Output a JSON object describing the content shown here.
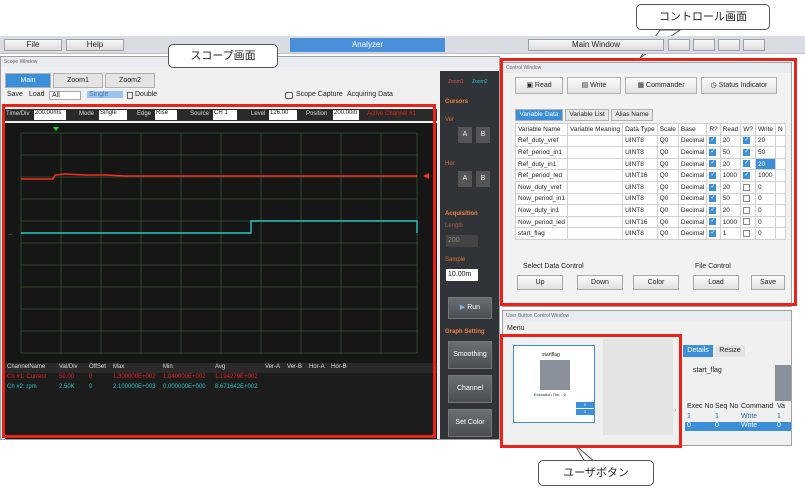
{
  "menubar": {
    "file": "File",
    "help": "Help",
    "analyzer": "Analyzer",
    "main_window": "Main Window"
  },
  "callouts": {
    "scope": "スコープ画面",
    "control": "コントロール画面",
    "user_button": "ユーザボタン"
  },
  "scope": {
    "title": "Scope Window",
    "tabs": [
      "Main",
      "Zoom1",
      "Zoom2"
    ],
    "toolbar": {
      "save": "Save",
      "load": "Load",
      "load_value": "All",
      "single": "Single",
      "double": "Double",
      "capture": "Scope Capture",
      "status": "Acquiring Data"
    },
    "controls": {
      "timediv_label": "Time/Div",
      "timediv": "200.00ms",
      "mode_label": "Mode",
      "mode": "Single",
      "edge_label": "Edge",
      "edge": "Rise",
      "source_label": "Source",
      "source": "CH 1",
      "level_label": "Level",
      "level": "126.00",
      "position_label": "Position",
      "position": "200.00m",
      "active": "Active Channel #1"
    },
    "side": {
      "zoom1": "Zoom1",
      "zoom2": "Zoom2",
      "cursors": "Cursors",
      "ver": "Ver",
      "hor": "Hor",
      "a": "A",
      "b": "B",
      "acquisition": "Acquisition",
      "length": "Length",
      "length_value": "200",
      "sample": "Sample",
      "sample_value": "10.00m",
      "run": "Run",
      "graph_setting": "Graph Setting",
      "smoothing": "Smoothing",
      "channel_setting": "Channel Setting",
      "set_color": "Set Color"
    },
    "table": {
      "headers": [
        "ChannelName",
        "Val/Div",
        "OffSet",
        "Max",
        "Min",
        "Avg",
        "Ver-A",
        "Ver-B",
        "Hor-A",
        "Hor-B"
      ],
      "rows": [
        [
          "Ch #1: Current",
          "50.00",
          "0",
          "1.300000E+002",
          "1.040000E+002",
          "1.194279E+002",
          "",
          "",
          "",
          ""
        ],
        [
          "Ch #2: rpm",
          "2.50K",
          "0",
          "2.100000E+003",
          "0.000000E+000",
          "8.671642E+002",
          "",
          "",
          "",
          ""
        ]
      ],
      "colors": [
        "#e8231a",
        "#29c5c0"
      ]
    }
  },
  "control": {
    "title": "Control Window",
    "tabs": [
      "Read",
      "Write",
      "Commander",
      "Status Indicator"
    ],
    "var_tabs": [
      "Variable Data",
      "Variable List",
      "Alias Name"
    ],
    "headers": [
      "Variable Name",
      "Variable Meaning",
      "Data Type",
      "Scale",
      "Base",
      "R?",
      "Read",
      "W?",
      "Write",
      "N"
    ],
    "rows": [
      {
        "name": "Ref_duty_vref",
        "type": "UINT8",
        "scale": "Q0",
        "base": "Decimal",
        "r": true,
        "read": "20",
        "w": true,
        "write": "20"
      },
      {
        "name": "Ref_period_in1",
        "type": "UINT8",
        "scale": "Q0",
        "base": "Decimal",
        "r": true,
        "read": "50",
        "w": true,
        "write": "50"
      },
      {
        "name": "Ref_duty_in1",
        "type": "UINT8",
        "scale": "Q0",
        "base": "Decimal",
        "r": true,
        "read": "20",
        "w": true,
        "write": "20"
      },
      {
        "name": "Ref_period_led",
        "type": "UINT16",
        "scale": "Q0",
        "base": "Decimal",
        "r": true,
        "read": "1000",
        "w": true,
        "write": "1000"
      },
      {
        "name": "Now_duty_vref",
        "type": "UINT8",
        "scale": "Q0",
        "base": "Decimal",
        "r": true,
        "read": "20",
        "w": false,
        "write": "0"
      },
      {
        "name": "Now_period_in1",
        "type": "UINT8",
        "scale": "Q0",
        "base": "Decimal",
        "r": true,
        "read": "50",
        "w": false,
        "write": "0"
      },
      {
        "name": "Now_duty_in1",
        "type": "UINT8",
        "scale": "Q0",
        "base": "Decimal",
        "r": true,
        "read": "20",
        "w": false,
        "write": "0"
      },
      {
        "name": "Now_period_led",
        "type": "UINT16",
        "scale": "Q0",
        "base": "Decimal",
        "r": true,
        "read": "1000",
        "w": false,
        "write": "0"
      },
      {
        "name": "start_flag",
        "type": "UINT8",
        "scale": "Q0",
        "base": "Decimal",
        "r": true,
        "read": "1",
        "w": false,
        "write": "0"
      }
    ],
    "select_data": "Select Data Control",
    "file_control": "File Control",
    "up": "Up",
    "down": "Down",
    "color": "Color",
    "load": "Load",
    "save": "Save"
  },
  "user": {
    "title": "User Button Control Window",
    "menu": "Menu",
    "card_title": "startflag",
    "card_exec": "Execution Tim. : 0",
    "card_v1": "0",
    "card_v2": "1",
    "tabs": [
      "Details",
      "Resize"
    ],
    "detail_name": "start_flag",
    "headers": [
      "Exec No",
      "Seq No",
      "Command",
      "Va"
    ],
    "rows": [
      [
        "1",
        "1",
        "Write",
        "1"
      ],
      [
        "0",
        "0",
        "Write",
        "0"
      ]
    ]
  }
}
